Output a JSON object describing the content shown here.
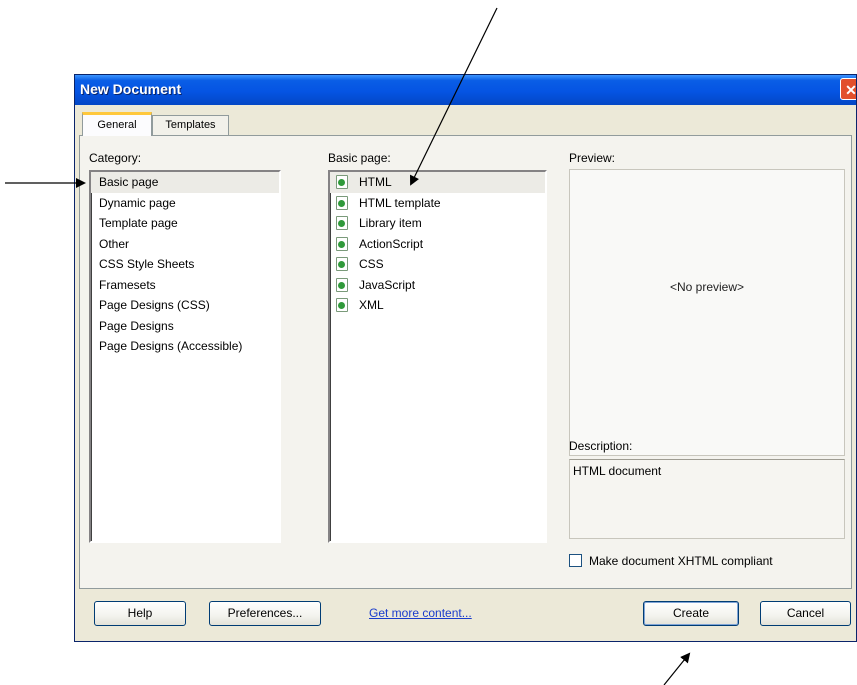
{
  "window": {
    "title": "New Document",
    "close_icon": "close-icon"
  },
  "tabs": [
    {
      "label": "General",
      "selected": true
    },
    {
      "label": "Templates",
      "selected": false
    }
  ],
  "category": {
    "label": "Category:",
    "items": [
      "Basic page",
      "Dynamic page",
      "Template page",
      "Other",
      "CSS Style Sheets",
      "Framesets",
      "Page Designs (CSS)",
      "Page Designs",
      "Page Designs (Accessible)"
    ],
    "selected": "Basic page"
  },
  "basic_page": {
    "label": "Basic page:",
    "items": [
      "HTML",
      "HTML template",
      "Library item",
      "ActionScript",
      "CSS",
      "JavaScript",
      "XML"
    ],
    "selected": "HTML",
    "item_icon": "document-icon"
  },
  "preview": {
    "label": "Preview:",
    "placeholder": "<No preview>"
  },
  "description": {
    "label": "Description:",
    "text": "HTML document"
  },
  "xhtml_checkbox": {
    "label": "Make document XHTML compliant",
    "checked": false
  },
  "buttons": {
    "help": "Help",
    "preferences": "Preferences...",
    "get_more": "Get more content...",
    "create": "Create",
    "cancel": "Cancel"
  },
  "colors": {
    "titlebar": "#0554e3",
    "dialog_bg": "#ece9d8",
    "link": "#1a3ccc",
    "selection": "#ecebe6"
  }
}
